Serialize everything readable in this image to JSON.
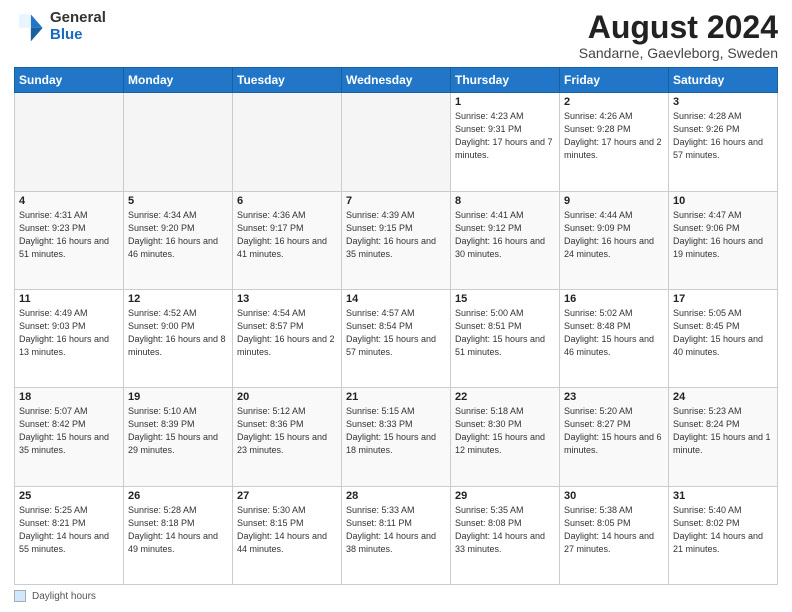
{
  "header": {
    "logo_general": "General",
    "logo_blue": "Blue",
    "title": "August 2024",
    "subtitle": "Sandarne, Gaevleborg, Sweden"
  },
  "weekdays": [
    "Sunday",
    "Monday",
    "Tuesday",
    "Wednesday",
    "Thursday",
    "Friday",
    "Saturday"
  ],
  "footer": {
    "legend_label": "Daylight hours"
  },
  "weeks": [
    [
      {
        "day": "",
        "info": ""
      },
      {
        "day": "",
        "info": ""
      },
      {
        "day": "",
        "info": ""
      },
      {
        "day": "",
        "info": ""
      },
      {
        "day": "1",
        "info": "Sunrise: 4:23 AM\nSunset: 9:31 PM\nDaylight: 17 hours\nand 7 minutes."
      },
      {
        "day": "2",
        "info": "Sunrise: 4:26 AM\nSunset: 9:28 PM\nDaylight: 17 hours\nand 2 minutes."
      },
      {
        "day": "3",
        "info": "Sunrise: 4:28 AM\nSunset: 9:26 PM\nDaylight: 16 hours\nand 57 minutes."
      }
    ],
    [
      {
        "day": "4",
        "info": "Sunrise: 4:31 AM\nSunset: 9:23 PM\nDaylight: 16 hours\nand 51 minutes."
      },
      {
        "day": "5",
        "info": "Sunrise: 4:34 AM\nSunset: 9:20 PM\nDaylight: 16 hours\nand 46 minutes."
      },
      {
        "day": "6",
        "info": "Sunrise: 4:36 AM\nSunset: 9:17 PM\nDaylight: 16 hours\nand 41 minutes."
      },
      {
        "day": "7",
        "info": "Sunrise: 4:39 AM\nSunset: 9:15 PM\nDaylight: 16 hours\nand 35 minutes."
      },
      {
        "day": "8",
        "info": "Sunrise: 4:41 AM\nSunset: 9:12 PM\nDaylight: 16 hours\nand 30 minutes."
      },
      {
        "day": "9",
        "info": "Sunrise: 4:44 AM\nSunset: 9:09 PM\nDaylight: 16 hours\nand 24 minutes."
      },
      {
        "day": "10",
        "info": "Sunrise: 4:47 AM\nSunset: 9:06 PM\nDaylight: 16 hours\nand 19 minutes."
      }
    ],
    [
      {
        "day": "11",
        "info": "Sunrise: 4:49 AM\nSunset: 9:03 PM\nDaylight: 16 hours\nand 13 minutes."
      },
      {
        "day": "12",
        "info": "Sunrise: 4:52 AM\nSunset: 9:00 PM\nDaylight: 16 hours\nand 8 minutes."
      },
      {
        "day": "13",
        "info": "Sunrise: 4:54 AM\nSunset: 8:57 PM\nDaylight: 16 hours\nand 2 minutes."
      },
      {
        "day": "14",
        "info": "Sunrise: 4:57 AM\nSunset: 8:54 PM\nDaylight: 15 hours\nand 57 minutes."
      },
      {
        "day": "15",
        "info": "Sunrise: 5:00 AM\nSunset: 8:51 PM\nDaylight: 15 hours\nand 51 minutes."
      },
      {
        "day": "16",
        "info": "Sunrise: 5:02 AM\nSunset: 8:48 PM\nDaylight: 15 hours\nand 46 minutes."
      },
      {
        "day": "17",
        "info": "Sunrise: 5:05 AM\nSunset: 8:45 PM\nDaylight: 15 hours\nand 40 minutes."
      }
    ],
    [
      {
        "day": "18",
        "info": "Sunrise: 5:07 AM\nSunset: 8:42 PM\nDaylight: 15 hours\nand 35 minutes."
      },
      {
        "day": "19",
        "info": "Sunrise: 5:10 AM\nSunset: 8:39 PM\nDaylight: 15 hours\nand 29 minutes."
      },
      {
        "day": "20",
        "info": "Sunrise: 5:12 AM\nSunset: 8:36 PM\nDaylight: 15 hours\nand 23 minutes."
      },
      {
        "day": "21",
        "info": "Sunrise: 5:15 AM\nSunset: 8:33 PM\nDaylight: 15 hours\nand 18 minutes."
      },
      {
        "day": "22",
        "info": "Sunrise: 5:18 AM\nSunset: 8:30 PM\nDaylight: 15 hours\nand 12 minutes."
      },
      {
        "day": "23",
        "info": "Sunrise: 5:20 AM\nSunset: 8:27 PM\nDaylight: 15 hours\nand 6 minutes."
      },
      {
        "day": "24",
        "info": "Sunrise: 5:23 AM\nSunset: 8:24 PM\nDaylight: 15 hours\nand 1 minute."
      }
    ],
    [
      {
        "day": "25",
        "info": "Sunrise: 5:25 AM\nSunset: 8:21 PM\nDaylight: 14 hours\nand 55 minutes."
      },
      {
        "day": "26",
        "info": "Sunrise: 5:28 AM\nSunset: 8:18 PM\nDaylight: 14 hours\nand 49 minutes."
      },
      {
        "day": "27",
        "info": "Sunrise: 5:30 AM\nSunset: 8:15 PM\nDaylight: 14 hours\nand 44 minutes."
      },
      {
        "day": "28",
        "info": "Sunrise: 5:33 AM\nSunset: 8:11 PM\nDaylight: 14 hours\nand 38 minutes."
      },
      {
        "day": "29",
        "info": "Sunrise: 5:35 AM\nSunset: 8:08 PM\nDaylight: 14 hours\nand 33 minutes."
      },
      {
        "day": "30",
        "info": "Sunrise: 5:38 AM\nSunset: 8:05 PM\nDaylight: 14 hours\nand 27 minutes."
      },
      {
        "day": "31",
        "info": "Sunrise: 5:40 AM\nSunset: 8:02 PM\nDaylight: 14 hours\nand 21 minutes."
      }
    ]
  ]
}
